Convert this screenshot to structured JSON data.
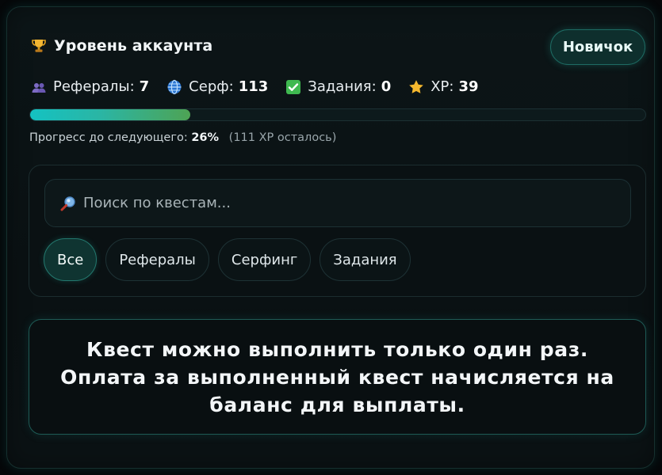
{
  "account": {
    "title": "Уровень аккаунта",
    "level_badge": "Новичок"
  },
  "stats": [
    {
      "icon": "people-icon",
      "label": "Рефералы:",
      "value": "7"
    },
    {
      "icon": "globe-icon",
      "label": "Серф:",
      "value": "113"
    },
    {
      "icon": "checkbox-icon",
      "label": "Задания:",
      "value": "0"
    },
    {
      "icon": "star-icon",
      "label": "XP:",
      "value": "39"
    }
  ],
  "progress": {
    "percent": 26,
    "label": "Прогресс до следующего:",
    "percent_text": "26%",
    "remaining_text": "(111 XP осталось)"
  },
  "search": {
    "placeholder": "Поиск по квестам..."
  },
  "filters": [
    {
      "label": "Все",
      "active": true
    },
    {
      "label": "Рефералы",
      "active": false
    },
    {
      "label": "Серфинг",
      "active": false
    },
    {
      "label": "Задания",
      "active": false
    }
  ],
  "notice": {
    "text": "Квест можно выполнить только один раз. Оплата за выполненный квест начисляется на баланс для выплаты."
  },
  "colors": {
    "accent": "#1fb5a8",
    "background": "#050709",
    "progress_start": "#14c2c2",
    "progress_end": "#4ea354"
  }
}
